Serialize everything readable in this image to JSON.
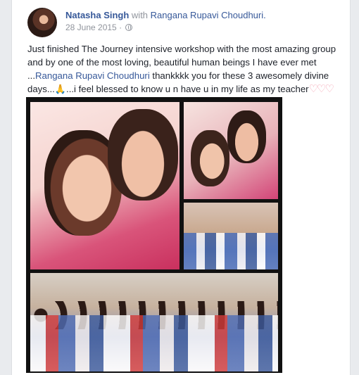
{
  "post": {
    "author": "Natasha Singh",
    "with_word": "with",
    "tagged": "Rangana Rupavi Choudhuri.",
    "date": "28 June 2015 ·",
    "privacy_icon": "globe-icon",
    "text_1": "Just finished The Journey intensive workshop with the most amazing group and by one of the most loving, beautiful human beings I have ever met ...",
    "text_link": "Rangana Rupavi Choudhuri",
    "text_2": " thankkkk you for these 3 awesomely divine days...",
    "text_hands": "🙏",
    "text_3": "...i feel blessed to know u n have u in my life as my teacher",
    "text_hearts": "♡♡♡"
  },
  "photo": {
    "collage_description_icon": "photo-collage"
  }
}
